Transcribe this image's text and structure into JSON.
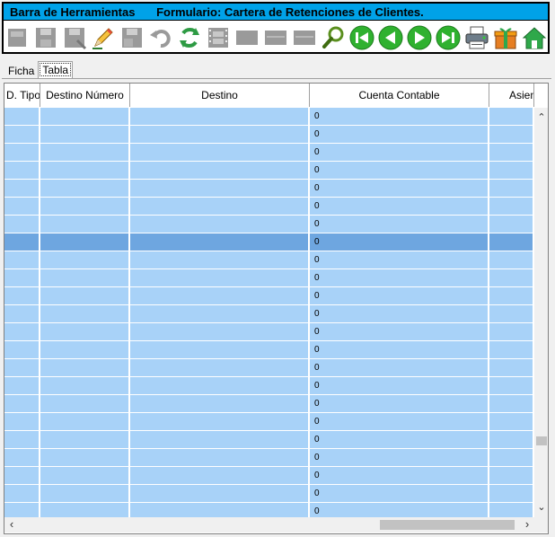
{
  "toolbar": {
    "title": "Barra de Herramientas",
    "form_title": "Formulario: Cartera de Retenciones de Clientes.",
    "buttons": [
      {
        "icon": "new-icon",
        "enabled": false
      },
      {
        "icon": "save-icon",
        "enabled": false
      },
      {
        "icon": "save-as-icon",
        "enabled": false
      },
      {
        "icon": "edit-pencil-icon",
        "enabled": true
      },
      {
        "icon": "save-close-icon",
        "enabled": false
      },
      {
        "icon": "undo-icon",
        "enabled": false
      },
      {
        "icon": "refresh-icon",
        "enabled": true
      },
      {
        "icon": "film-icon",
        "enabled": false
      },
      {
        "icon": "blank-a-icon",
        "enabled": false
      },
      {
        "icon": "blank-b-icon",
        "enabled": false
      },
      {
        "icon": "blank-c-icon",
        "enabled": false
      },
      {
        "icon": "search-icon",
        "enabled": true
      },
      {
        "icon": "first-record-icon",
        "enabled": true
      },
      {
        "icon": "previous-record-icon",
        "enabled": true
      },
      {
        "icon": "next-record-icon",
        "enabled": true
      },
      {
        "icon": "last-record-icon",
        "enabled": true
      },
      {
        "icon": "printer-icon",
        "enabled": true
      },
      {
        "icon": "gift-icon",
        "enabled": true
      },
      {
        "icon": "home-icon",
        "enabled": true
      }
    ]
  },
  "tabs": [
    {
      "label": "Ficha",
      "active": false
    },
    {
      "label": "Tabla",
      "active": true
    }
  ],
  "grid": {
    "columns": [
      "D. Tipo",
      "Destino Número",
      "Destino",
      "Cuenta Contable",
      "Asien"
    ],
    "rows": [
      [
        "",
        "",
        "",
        "0",
        ""
      ],
      [
        "",
        "",
        "",
        "0",
        ""
      ],
      [
        "",
        "",
        "",
        "0",
        ""
      ],
      [
        "",
        "",
        "",
        "0",
        ""
      ],
      [
        "",
        "",
        "",
        "0",
        ""
      ],
      [
        "",
        "",
        "",
        "0",
        ""
      ],
      [
        "",
        "",
        "",
        "0",
        ""
      ],
      [
        "",
        "",
        "",
        "0",
        ""
      ],
      [
        "",
        "",
        "",
        "0",
        ""
      ],
      [
        "",
        "",
        "",
        "0",
        ""
      ],
      [
        "",
        "",
        "",
        "0",
        ""
      ],
      [
        "",
        "",
        "",
        "0",
        ""
      ],
      [
        "",
        "",
        "",
        "0",
        ""
      ],
      [
        "",
        "",
        "",
        "0",
        ""
      ],
      [
        "",
        "",
        "",
        "0",
        ""
      ],
      [
        "",
        "",
        "",
        "0",
        ""
      ],
      [
        "",
        "",
        "",
        "0",
        ""
      ],
      [
        "",
        "",
        "",
        "0",
        ""
      ],
      [
        "",
        "",
        "",
        "0",
        ""
      ],
      [
        "",
        "",
        "",
        "0",
        ""
      ],
      [
        "",
        "",
        "",
        "0",
        ""
      ],
      [
        "",
        "",
        "",
        "0",
        ""
      ],
      [
        "",
        "",
        "",
        "0",
        ""
      ]
    ],
    "selected_row_index": 7
  },
  "colors": {
    "title_bar": "#00a2e8",
    "row_bg": "#a8d2f8",
    "row_selected_bg": "#6ea6e0",
    "nav_green": "#2fb12f",
    "disabled_gray": "#9a9a9a"
  }
}
